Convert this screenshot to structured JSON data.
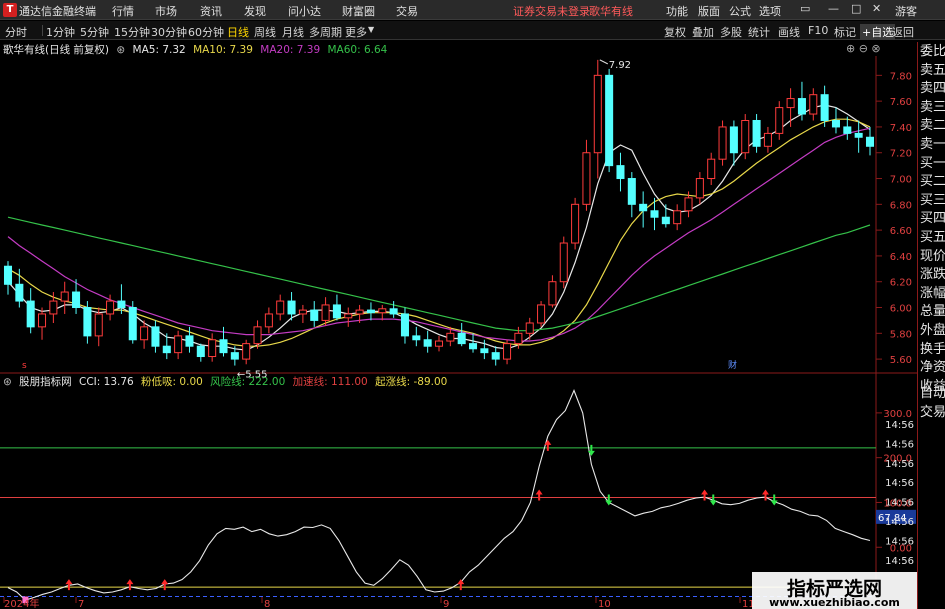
{
  "titlebar": {
    "logo_text": "T",
    "app_name": "通达信金融终端",
    "menu": [
      "行情",
      "市场",
      "资讯",
      "发现",
      "问小达",
      "财富圈",
      "交易"
    ],
    "warning": "证券交易未登录",
    "stock_name": "歌华有线",
    "right_menu": [
      "功能",
      "版面",
      "公式",
      "选项"
    ],
    "user": "游客",
    "window_buttons": [
      "▭",
      "—",
      "□",
      "✕"
    ]
  },
  "toolbar": {
    "periods": [
      "分时",
      "1分钟",
      "5分钟",
      "15分钟",
      "30分钟",
      "60分钟",
      "日线",
      "周线",
      "月线",
      "多周期",
      "更多"
    ],
    "active_period": "日线",
    "tools": [
      "复权",
      "叠加",
      "多股",
      "统计",
      "画线",
      "F10",
      "标记",
      "+自选",
      "返回"
    ]
  },
  "main_chart": {
    "stock_title": "歌华有线(日线 前复权)",
    "ma": [
      {
        "label": "MA5: 7.32",
        "color": "#e8e8e8"
      },
      {
        "label": "MA10: 7.39",
        "color": "#e8d84a"
      },
      {
        "label": "MA20: 7.39",
        "color": "#c43cc4"
      },
      {
        "label": "MA60: 6.64",
        "color": "#35c24a"
      }
    ],
    "price_ticks": [
      "7.80",
      "7.60",
      "7.40",
      "7.20",
      "7.00",
      "6.80",
      "6.60",
      "6.40",
      "6.20",
      "6.00",
      "5.80",
      "5.60"
    ],
    "high_label": "7.92",
    "low_label": "5.55",
    "marker_cai": "财",
    "marker_s": "s"
  },
  "side_panel": [
    "委比",
    "卖五",
    "卖四",
    "卖三",
    "卖二",
    "卖一",
    "买一",
    "买二",
    "买三",
    "买四",
    "买五",
    "现价",
    "涨跌",
    "涨幅",
    "总量",
    "外盘",
    "换手",
    "净资",
    "收益"
  ],
  "side_panel_lower": [
    "自动",
    "交易"
  ],
  "indicator": {
    "name": "股朋指标网",
    "cci": "CCI: 13.76",
    "fields": [
      {
        "label": "粉低吸: 0.00",
        "color": "#e8d84a"
      },
      {
        "label": "风险线: 222.00",
        "color": "#35c24a"
      },
      {
        "label": "加速线: 111.00",
        "color": "#e04040"
      },
      {
        "label": "起涨线: -89.00",
        "color": "#e8d84a"
      }
    ],
    "y_ticks": [
      "300.0",
      "200.0",
      "100.0",
      "0.00"
    ],
    "current_value": "67.84",
    "time_ticks": [
      "14:56",
      "14:56",
      "14:56",
      "14:56",
      "14:56",
      "14:56",
      "14:56",
      "14:56"
    ]
  },
  "x_axis": [
    "2024年",
    "7",
    "8",
    "9",
    "10",
    "11"
  ],
  "watermark": {
    "title": "指标严选网",
    "url": "www.xuezhibiao.com"
  },
  "chart_data": {
    "type": "candlestick",
    "price_range": [
      5.5,
      7.95
    ],
    "candles_ohlc": [
      [
        6.32,
        6.36,
        6.1,
        6.18
      ],
      [
        6.18,
        6.3,
        6.0,
        6.05
      ],
      [
        6.05,
        6.15,
        5.8,
        5.85
      ],
      [
        5.85,
        6.0,
        5.75,
        5.95
      ],
      [
        5.95,
        6.12,
        5.88,
        6.05
      ],
      [
        6.05,
        6.2,
        5.95,
        6.12
      ],
      [
        6.12,
        6.22,
        5.95,
        6.0
      ],
      [
        6.0,
        6.05,
        5.72,
        5.78
      ],
      [
        5.78,
        6.0,
        5.7,
        5.95
      ],
      [
        5.95,
        6.1,
        5.9,
        6.05
      ],
      [
        6.05,
        6.18,
        5.95,
        6.0
      ],
      [
        6.0,
        6.05,
        5.72,
        5.75
      ],
      [
        5.75,
        5.9,
        5.68,
        5.85
      ],
      [
        5.85,
        5.9,
        5.65,
        5.7
      ],
      [
        5.7,
        5.8,
        5.6,
        5.65
      ],
      [
        5.65,
        5.82,
        5.6,
        5.78
      ],
      [
        5.78,
        5.85,
        5.65,
        5.7
      ],
      [
        5.7,
        5.72,
        5.58,
        5.62
      ],
      [
        5.62,
        5.8,
        5.58,
        5.75
      ],
      [
        5.75,
        5.85,
        5.62,
        5.65
      ],
      [
        5.65,
        5.7,
        5.55,
        5.6
      ],
      [
        5.6,
        5.75,
        5.56,
        5.72
      ],
      [
        5.72,
        5.9,
        5.68,
        5.85
      ],
      [
        5.85,
        6.0,
        5.8,
        5.95
      ],
      [
        5.95,
        6.1,
        5.9,
        6.05
      ],
      [
        6.05,
        6.12,
        5.9,
        5.95
      ],
      [
        5.95,
        6.02,
        5.88,
        5.98
      ],
      [
        5.98,
        6.05,
        5.85,
        5.9
      ],
      [
        5.9,
        6.08,
        5.86,
        6.02
      ],
      [
        6.02,
        6.1,
        5.9,
        5.92
      ],
      [
        5.92,
        6.0,
        5.85,
        5.95
      ],
      [
        5.95,
        6.02,
        5.88,
        5.98
      ],
      [
        5.98,
        6.04,
        5.9,
        5.96
      ],
      [
        5.96,
        6.02,
        5.9,
        5.99
      ],
      [
        5.99,
        6.05,
        5.92,
        5.95
      ],
      [
        5.95,
        6.0,
        5.72,
        5.78
      ],
      [
        5.78,
        5.85,
        5.7,
        5.75
      ],
      [
        5.75,
        5.82,
        5.65,
        5.7
      ],
      [
        5.7,
        5.78,
        5.66,
        5.74
      ],
      [
        5.74,
        5.85,
        5.7,
        5.8
      ],
      [
        5.8,
        5.88,
        5.7,
        5.72
      ],
      [
        5.72,
        5.8,
        5.65,
        5.68
      ],
      [
        5.68,
        5.75,
        5.6,
        5.65
      ],
      [
        5.65,
        5.7,
        5.55,
        5.6
      ],
      [
        5.6,
        5.75,
        5.56,
        5.72
      ],
      [
        5.72,
        5.85,
        5.68,
        5.8
      ],
      [
        5.8,
        5.92,
        5.75,
        5.88
      ],
      [
        5.88,
        6.05,
        5.85,
        6.02
      ],
      [
        6.02,
        6.25,
        6.0,
        6.2
      ],
      [
        6.2,
        6.55,
        6.15,
        6.5
      ],
      [
        6.5,
        6.85,
        6.45,
        6.8
      ],
      [
        6.8,
        7.3,
        6.75,
        7.2
      ],
      [
        7.2,
        7.92,
        7.0,
        7.8
      ],
      [
        7.8,
        7.85,
        7.05,
        7.1
      ],
      [
        7.1,
        7.2,
        6.9,
        7.0
      ],
      [
        7.0,
        7.05,
        6.7,
        6.8
      ],
      [
        6.8,
        6.9,
        6.62,
        6.75
      ],
      [
        6.75,
        6.85,
        6.6,
        6.7
      ],
      [
        6.7,
        6.8,
        6.62,
        6.65
      ],
      [
        6.65,
        6.8,
        6.6,
        6.75
      ],
      [
        6.75,
        6.9,
        6.7,
        6.85
      ],
      [
        6.85,
        7.05,
        6.8,
        7.0
      ],
      [
        7.0,
        7.2,
        6.95,
        7.15
      ],
      [
        7.15,
        7.45,
        7.1,
        7.4
      ],
      [
        7.4,
        7.45,
        7.1,
        7.2
      ],
      [
        7.2,
        7.5,
        7.15,
        7.45
      ],
      [
        7.45,
        7.5,
        7.2,
        7.25
      ],
      [
        7.25,
        7.4,
        7.2,
        7.35
      ],
      [
        7.35,
        7.6,
        7.3,
        7.55
      ],
      [
        7.55,
        7.7,
        7.4,
        7.62
      ],
      [
        7.62,
        7.75,
        7.45,
        7.5
      ],
      [
        7.5,
        7.7,
        7.45,
        7.65
      ],
      [
        7.65,
        7.72,
        7.4,
        7.45
      ],
      [
        7.45,
        7.55,
        7.35,
        7.4
      ],
      [
        7.4,
        7.48,
        7.3,
        7.35
      ],
      [
        7.35,
        7.45,
        7.2,
        7.32
      ],
      [
        7.32,
        7.4,
        7.18,
        7.25
      ]
    ],
    "ma_lines": {
      "MA5": [
        6.2,
        6.1,
        6.0,
        5.97,
        5.98,
        6.02,
        6.02,
        5.98,
        5.96,
        5.97,
        6.0,
        5.95,
        5.88,
        5.83,
        5.77,
        5.76,
        5.74,
        5.71,
        5.7,
        5.7,
        5.68,
        5.67,
        5.71,
        5.77,
        5.84,
        5.92,
        5.96,
        5.98,
        5.98,
        5.97,
        5.95,
        5.96,
        5.97,
        5.97,
        5.96,
        5.92,
        5.87,
        5.83,
        5.79,
        5.76,
        5.76,
        5.74,
        5.72,
        5.69,
        5.68,
        5.71,
        5.77,
        5.84,
        5.95,
        6.12,
        6.35,
        6.62,
        6.96,
        7.2,
        7.26,
        7.22,
        7.04,
        6.88,
        6.77,
        6.74,
        6.75,
        6.8,
        6.87,
        6.98,
        7.12,
        7.23,
        7.3,
        7.33,
        7.38,
        7.45,
        7.5,
        7.55,
        7.57,
        7.55,
        7.5,
        7.44,
        7.38
      ],
      "MA10": [
        6.3,
        6.25,
        6.18,
        6.12,
        6.08,
        6.05,
        6.03,
        6.0,
        5.99,
        5.98,
        5.98,
        5.96,
        5.93,
        5.9,
        5.87,
        5.84,
        5.81,
        5.78,
        5.75,
        5.73,
        5.71,
        5.7,
        5.7,
        5.71,
        5.73,
        5.76,
        5.8,
        5.84,
        5.88,
        5.91,
        5.93,
        5.95,
        5.96,
        5.96,
        5.96,
        5.95,
        5.93,
        5.9,
        5.87,
        5.84,
        5.82,
        5.8,
        5.77,
        5.74,
        5.72,
        5.71,
        5.71,
        5.73,
        5.76,
        5.82,
        5.9,
        6.02,
        6.18,
        6.35,
        6.52,
        6.65,
        6.75,
        6.82,
        6.86,
        6.88,
        6.87,
        6.86,
        6.88,
        6.92,
        6.98,
        7.05,
        7.12,
        7.18,
        7.24,
        7.3,
        7.35,
        7.4,
        7.44,
        7.46,
        7.46,
        7.44,
        7.4
      ],
      "MA20": [
        6.55,
        6.48,
        6.42,
        6.36,
        6.3,
        6.24,
        6.19,
        6.14,
        6.1,
        6.06,
        6.03,
        6.0,
        5.97,
        5.94,
        5.91,
        5.88,
        5.86,
        5.84,
        5.82,
        5.81,
        5.8,
        5.79,
        5.79,
        5.79,
        5.8,
        5.81,
        5.82,
        5.84,
        5.86,
        5.88,
        5.89,
        5.9,
        5.91,
        5.91,
        5.91,
        5.9,
        5.89,
        5.87,
        5.85,
        5.83,
        5.81,
        5.79,
        5.77,
        5.76,
        5.75,
        5.74,
        5.74,
        5.75,
        5.77,
        5.8,
        5.84,
        5.9,
        5.98,
        6.07,
        6.16,
        6.25,
        6.33,
        6.4,
        6.46,
        6.52,
        6.58,
        6.63,
        6.68,
        6.74,
        6.8,
        6.86,
        6.92,
        6.98,
        7.04,
        7.1,
        7.16,
        7.22,
        7.28,
        7.32,
        7.35,
        7.37,
        7.39
      ],
      "MA60": [
        6.7,
        6.68,
        6.66,
        6.64,
        6.62,
        6.6,
        6.58,
        6.56,
        6.54,
        6.52,
        6.5,
        6.48,
        6.46,
        6.44,
        6.42,
        6.4,
        6.38,
        6.36,
        6.34,
        6.32,
        6.3,
        6.28,
        6.26,
        6.24,
        6.22,
        6.2,
        6.18,
        6.16,
        6.14,
        6.12,
        6.1,
        6.08,
        6.06,
        6.04,
        6.02,
        6.0,
        5.98,
        5.96,
        5.94,
        5.92,
        5.9,
        5.88,
        5.86,
        5.84,
        5.83,
        5.82,
        5.82,
        5.83,
        5.84,
        5.86,
        5.88,
        5.9,
        5.93,
        5.96,
        5.99,
        6.02,
        6.05,
        6.08,
        6.11,
        6.14,
        6.17,
        6.2,
        6.23,
        6.26,
        6.29,
        6.32,
        6.35,
        6.38,
        6.41,
        6.44,
        6.47,
        6.5,
        6.53,
        6.56,
        6.58,
        6.61,
        6.64
      ]
    },
    "cci": [
      -90,
      -100,
      -118,
      -112,
      -105,
      -100,
      -92,
      -85,
      -82,
      -90,
      -97,
      -102,
      -100,
      -95,
      -88,
      -92,
      -95,
      -92,
      -82,
      -80,
      -72,
      -55,
      -30,
      5,
      30,
      42,
      40,
      45,
      35,
      40,
      30,
      25,
      28,
      35,
      45,
      44,
      50,
      42,
      15,
      -20,
      -55,
      -80,
      -85,
      -70,
      -50,
      -28,
      -40,
      -65,
      -95,
      -100,
      -98,
      -90,
      -78,
      -55,
      -40,
      -20,
      0,
      20,
      35,
      60,
      100,
      180,
      248,
      285,
      305,
      350,
      300,
      185,
      125,
      100,
      90,
      80,
      70,
      76,
      80,
      88,
      92,
      98,
      105,
      110,
      112,
      105,
      97,
      95,
      98,
      105,
      110,
      112,
      102,
      95,
      85,
      80,
      72,
      70,
      60,
      42,
      35,
      28,
      20,
      15
    ]
  }
}
